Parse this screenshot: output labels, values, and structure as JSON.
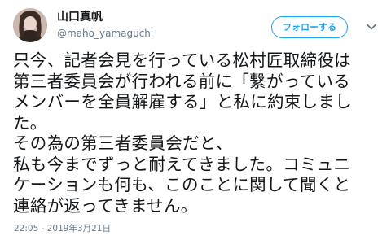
{
  "user": {
    "display_name": "山口真帆",
    "handle": "@maho_yamaguchi"
  },
  "actions": {
    "follow_label": "フォローする",
    "more_icon": "chevron-down-icon"
  },
  "tweet": {
    "text": "只今、記者会見を行っている松村匠取締役は\n第三者委員会が行われる前に「繋がっている\nメンバーを全員解雇する」と私に約束しまし\nた。\nその為の第三者委員会だと、\n私も今までずっと耐えてきました。コミュニ\nケーションも何も、このことに関して聞くと\n連絡が返ってきません。",
    "timestamp": "22:05 - 2019年3月21日"
  },
  "colors": {
    "accent": "#1da1f2",
    "text": "#14171a",
    "secondary": "#657786"
  }
}
